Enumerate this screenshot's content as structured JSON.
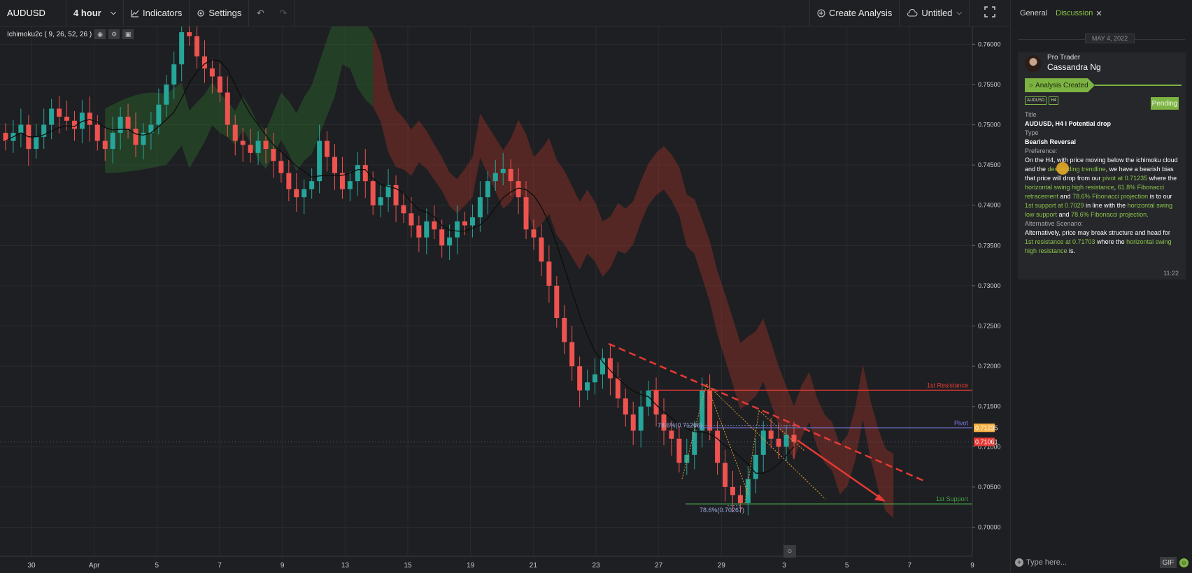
{
  "toolbar": {
    "symbol": "AUDUSD",
    "interval": "4 hour",
    "indicators": "Indicators",
    "settings": "Settings",
    "create_analysis": "Create Analysis",
    "layout": "Untitled"
  },
  "legend": {
    "indicator": "Ichimoku2c ( 9, 26, 52, 26 )"
  },
  "chart_data": {
    "type": "candlestick",
    "symbol": "AUDUSD",
    "interval": "4 hour",
    "ylim": [
      0.6964,
      0.7622
    ],
    "y_ticks": [
      0.76,
      0.755,
      0.75,
      0.745,
      0.74,
      0.735,
      0.73,
      0.725,
      0.72,
      0.715,
      0.71,
      0.705,
      0.7
    ],
    "x_ticks": [
      "30",
      "Apr",
      "5",
      "7",
      "9",
      "13",
      "15",
      "19",
      "21",
      "23",
      "27",
      "29",
      "3",
      "5",
      "7",
      "9"
    ],
    "levels": [
      {
        "label": "1st Resistance",
        "value": 0.71703,
        "color": "#e53935"
      },
      {
        "label": "Pivot",
        "value": 0.71235,
        "color": "#7c7ce8"
      },
      {
        "label": "1st Support",
        "value": 0.7029,
        "color": "#43a047"
      }
    ],
    "current_price": 0.71061,
    "price_badges": [
      {
        "value": "0.71235",
        "price": 0.71235,
        "color": "#f5b041"
      },
      {
        "value": "0.71061",
        "price": 0.71061,
        "color": "#e53935"
      }
    ],
    "fib_labels": [
      {
        "text": "78.6%(0.71266)",
        "price": 0.71266
      },
      {
        "text": "78.6%(0.70267)",
        "price": 0.70267
      }
    ],
    "closes": [
      0.748,
      0.749,
      0.75,
      0.747,
      0.7485,
      0.75,
      0.752,
      0.751,
      0.7505,
      0.7495,
      0.7515,
      0.75,
      0.748,
      0.747,
      0.749,
      0.751,
      0.7495,
      0.7475,
      0.749,
      0.75,
      0.7525,
      0.755,
      0.7575,
      0.7615,
      0.761,
      0.7585,
      0.757,
      0.756,
      0.754,
      0.75,
      0.748,
      0.7475,
      0.7465,
      0.748,
      0.747,
      0.7455,
      0.744,
      0.742,
      0.741,
      0.742,
      0.743,
      0.748,
      0.746,
      0.744,
      0.742,
      0.743,
      0.745,
      0.743,
      0.74,
      0.741,
      0.7425,
      0.74,
      0.739,
      0.7375,
      0.736,
      0.738,
      0.737,
      0.735,
      0.736,
      0.738,
      0.7375,
      0.7385,
      0.741,
      0.743,
      0.744,
      0.7445,
      0.743,
      0.741,
      0.737,
      0.736,
      0.733,
      0.73,
      0.726,
      0.723,
      0.72,
      0.717,
      0.718,
      0.719,
      0.721,
      0.7185,
      0.716,
      0.714,
      0.712,
      0.715,
      0.717,
      0.714,
      0.712,
      0.711,
      0.708,
      0.709,
      0.712,
      0.717,
      0.712,
      0.708,
      0.705,
      0.704,
      0.703,
      0.706,
      0.709,
      0.712,
      0.711,
      0.71,
      0.7115,
      0.7106
    ]
  },
  "panel": {
    "tabs": [
      {
        "label": "General"
      },
      {
        "label": "Discussion"
      }
    ],
    "date": "MAY 4, 2022",
    "post": {
      "role": "Pro Trader",
      "author": "Cassandra Ng",
      "status_ribbon": "Analysis Created",
      "tags": [
        "AUDUSD",
        "H4"
      ],
      "status": "Pending",
      "title_label": "Title",
      "title": "AUDUSD, H4 I Potential drop",
      "type_label": "Type",
      "type": "Bearish Reversal",
      "preference_label": "Preference:",
      "preference": {
        "t1": "On the H4, with price moving below the ichimoku cloud and the ",
        "h1": "descending trendline",
        "t2": ", we have a bearish bias that price will drop from our ",
        "h2": "pivot at 0.71235",
        "t3": " where the ",
        "h3": "horizontal swing high resistance",
        "t4": ", ",
        "h4": "61.8% Fibonacci retracement",
        "t5": " and ",
        "h5": "78.6% Fibonacci projection",
        "t6": " is to our ",
        "h6": "1st support at 0.7029",
        "t7": " in line with the ",
        "h7": "horizontal swing low support",
        "t8": " and ",
        "h8": "78.6% Fibonacci projection.",
        "t9": ""
      },
      "alt_label": "Alternative Scenario:",
      "alternative": {
        "t1": "Alternatively, price may break structure and head for ",
        "h1": "1st resistance at 0.71703",
        "t2": " where the ",
        "h2": "horizontal swing high resistance",
        "t3": " is."
      },
      "time": "11:22"
    },
    "input_placeholder": "Type here...",
    "gif_label": "GIF"
  }
}
